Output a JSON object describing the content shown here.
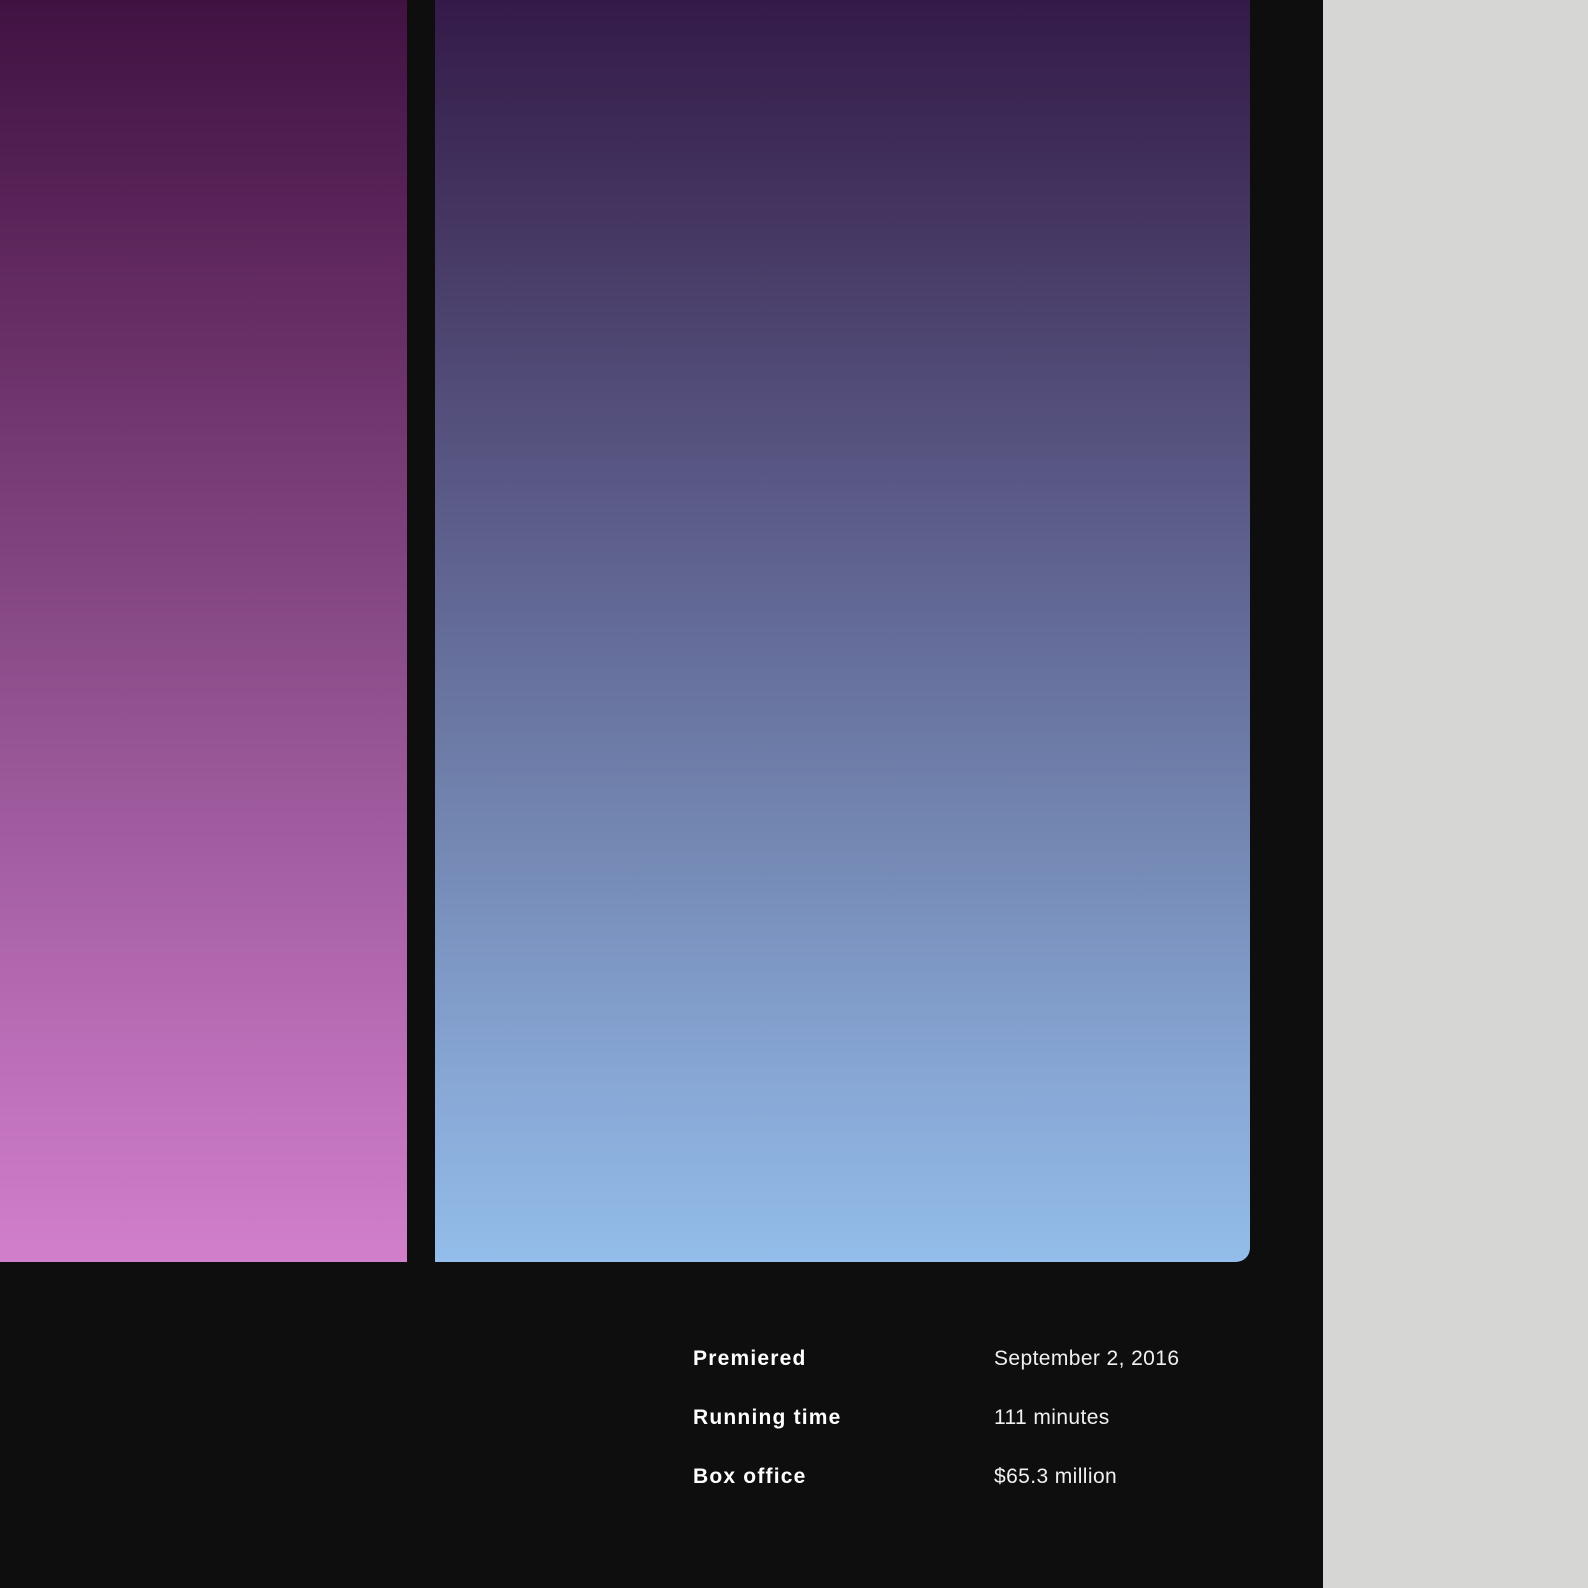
{
  "colors": {
    "page_background": "#0e0e0e",
    "gutter_background": "#d6d6d4",
    "left_poster_top": "#401242",
    "left_poster_bottom": "#d17fca",
    "right_poster_top": "#341a48",
    "right_poster_bottom": "#93bdea",
    "label_text": "#ffffff",
    "value_text": "#f0f0f0"
  },
  "info": {
    "rows": [
      {
        "label": "Premiered",
        "value": "September 2, 2016"
      },
      {
        "label": "Running time",
        "value": "111 minutes"
      },
      {
        "label": "Box office",
        "value": "$65.3 million"
      }
    ]
  }
}
